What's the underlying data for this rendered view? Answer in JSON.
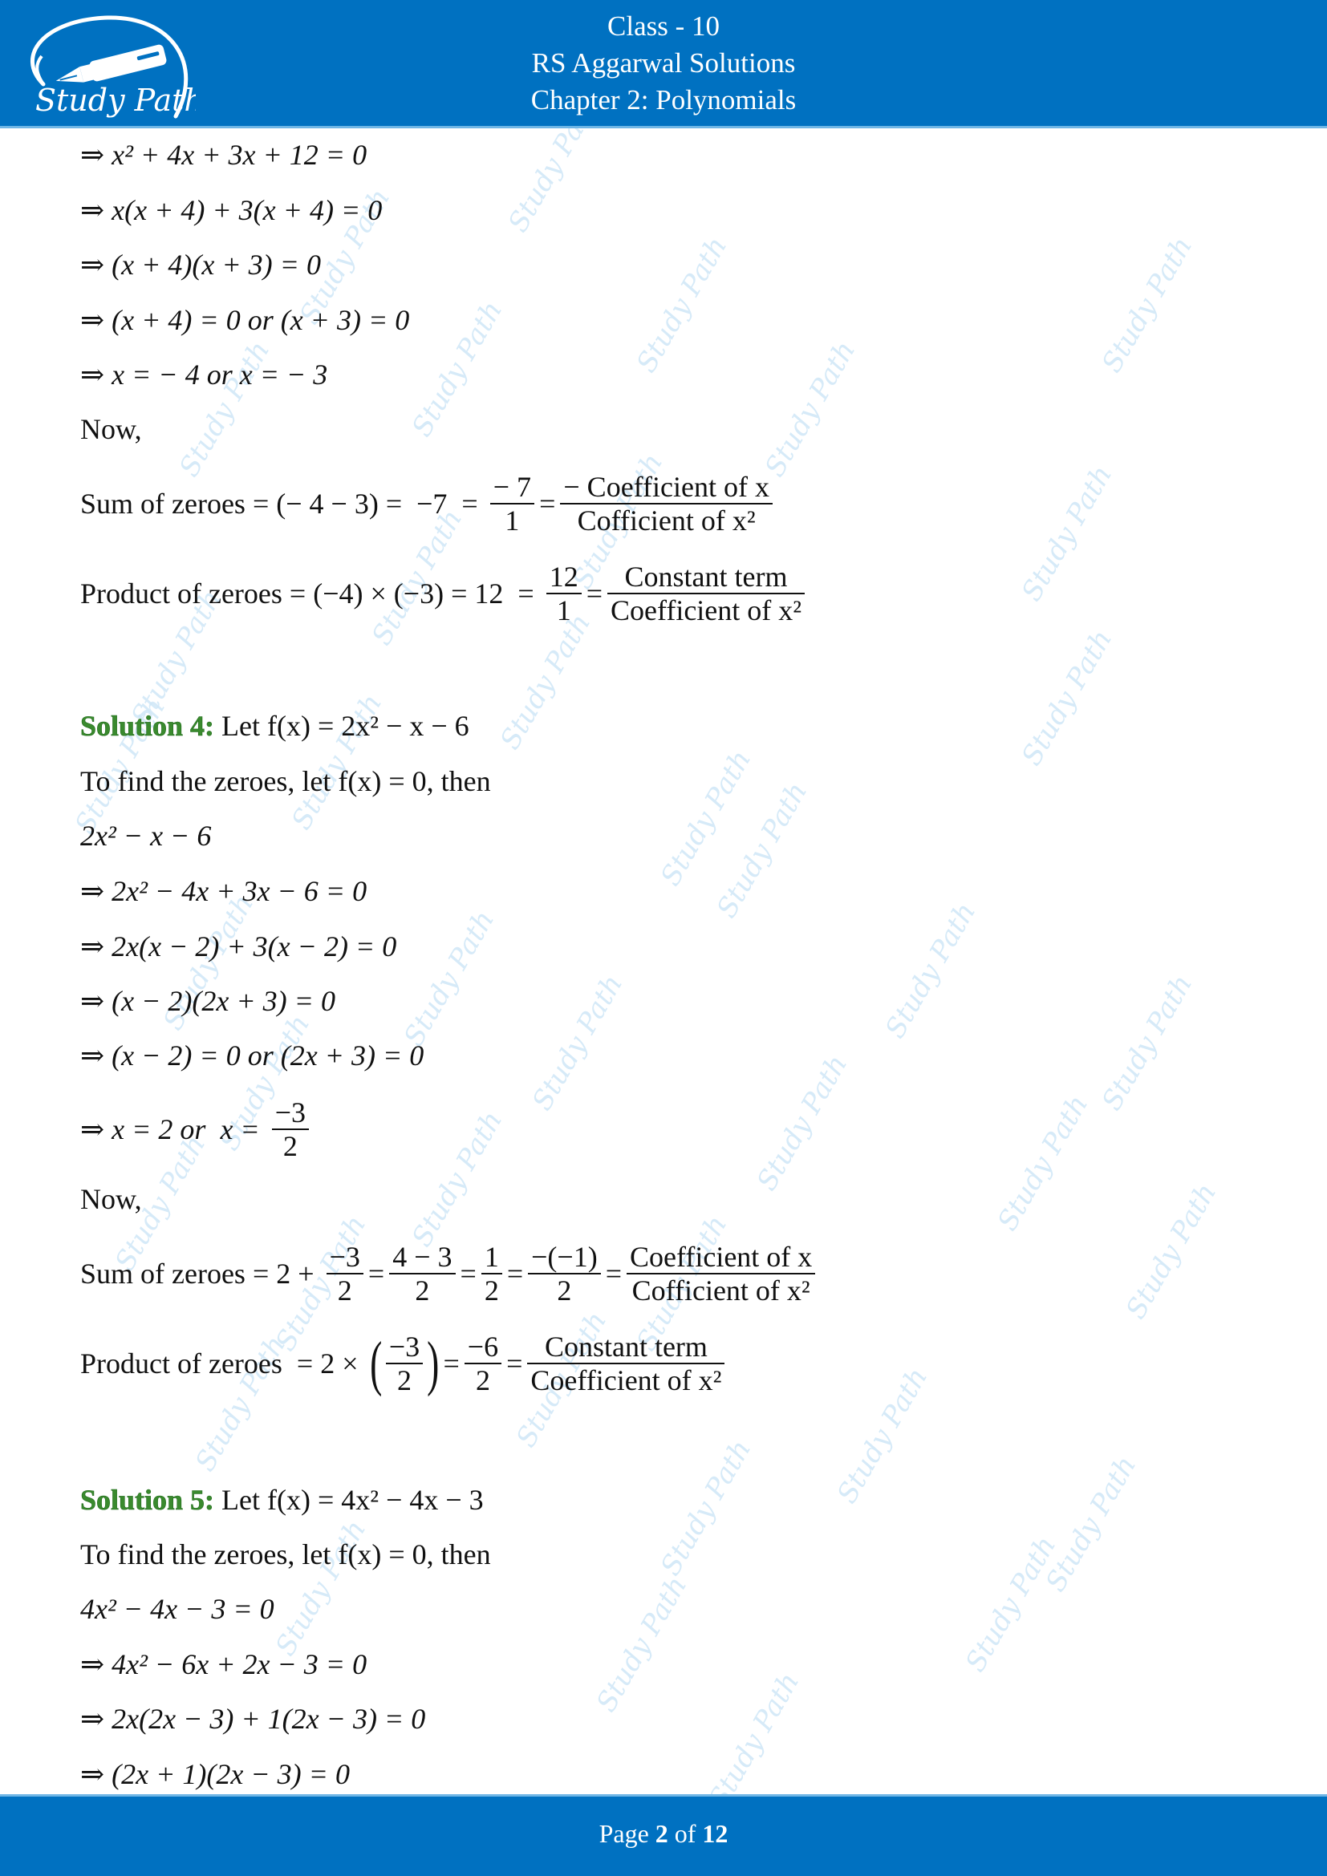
{
  "header": {
    "logo_text": "Study Path",
    "line1": "Class - 10",
    "line2": "RS Aggarwal Solutions",
    "line3": "Chapter 2: Polynomials",
    "bg_color": "#0071c1"
  },
  "watermark_text": "Study Path",
  "content": {
    "top_steps": [
      "⇒ x² + 4x + 3x + 12 = 0",
      "⇒ x(x + 4) + 3(x + 4) = 0",
      "⇒ (x + 4)(x + 3) = 0",
      "⇒ (x + 4) = 0 or (x + 3) = 0",
      "⇒ x = − 4 or x = − 3"
    ],
    "now1": "Now,",
    "sum1": {
      "label": "Sum of zeroes = (− 4 − 3) =  −7  = ",
      "frac1_num": "− 7",
      "frac1_den": "1",
      "frac2_num": "− Coefficient of x",
      "frac2_den": "Cofficient of x²"
    },
    "prod1": {
      "label": "Product of zeroes = (−4) × (−3) = 12  = ",
      "frac1_num": "12",
      "frac1_den": "1",
      "frac2_num": "Constant term",
      "frac2_den": "Coefficient of x²"
    },
    "solution4": {
      "heading": "Solution 4:",
      "statement": "Let f(x) = 2x² − x − 6",
      "intro": "To find the zeroes, let f(x) = 0, then",
      "steps": [
        "2x² − x − 6",
        "⇒ 2x² − 4x + 3x − 6 = 0",
        "⇒ 2x(x − 2) + 3(x − 2) = 0",
        "⇒ (x − 2)(2x + 3) = 0",
        "⇒ (x − 2) = 0 or (2x + 3) = 0"
      ],
      "root_prefix": "⇒ x = 2 or  x = ",
      "root_num": "−3",
      "root_den": "2",
      "now": "Now,",
      "sum": {
        "label": "Sum of zeroes = 2 + ",
        "f1_num": "−3",
        "f1_den": "2",
        "f2_num": "4 − 3",
        "f2_den": "2",
        "f3_num": "1",
        "f3_den": "2",
        "f4_num": "−(−1)",
        "f4_den": "2",
        "f5_num": "Coefficient of x",
        "f5_den": "Cofficient of x²"
      },
      "product": {
        "label": "Product of zeroes  = 2 × ",
        "f1_num": "−3",
        "f1_den": "2",
        "f2_num": "−6",
        "f2_den": "2",
        "f3_num": "Constant term",
        "f3_den": "Coefficient of x²"
      }
    },
    "solution5": {
      "heading": "Solution 5:",
      "statement": "Let f(x) = 4x² − 4x − 3",
      "intro": "To find the zeroes, let f(x) = 0, then",
      "steps": [
        "4x² − 4x − 3 = 0",
        "⇒ 4x² − 6x + 2x − 3 = 0",
        "⇒ 2x(2x − 3) + 1(2x − 3) = 0",
        "⇒ (2x + 1)(2x − 3) = 0"
      ]
    }
  },
  "footer": {
    "page_prefix": "Page ",
    "current_page": "2",
    "page_mid": " of ",
    "total_pages": "12"
  },
  "colors": {
    "brand_blue": "#0071c1",
    "solution_green": "#3a8a2e",
    "watermark": "#cfe7f7"
  }
}
